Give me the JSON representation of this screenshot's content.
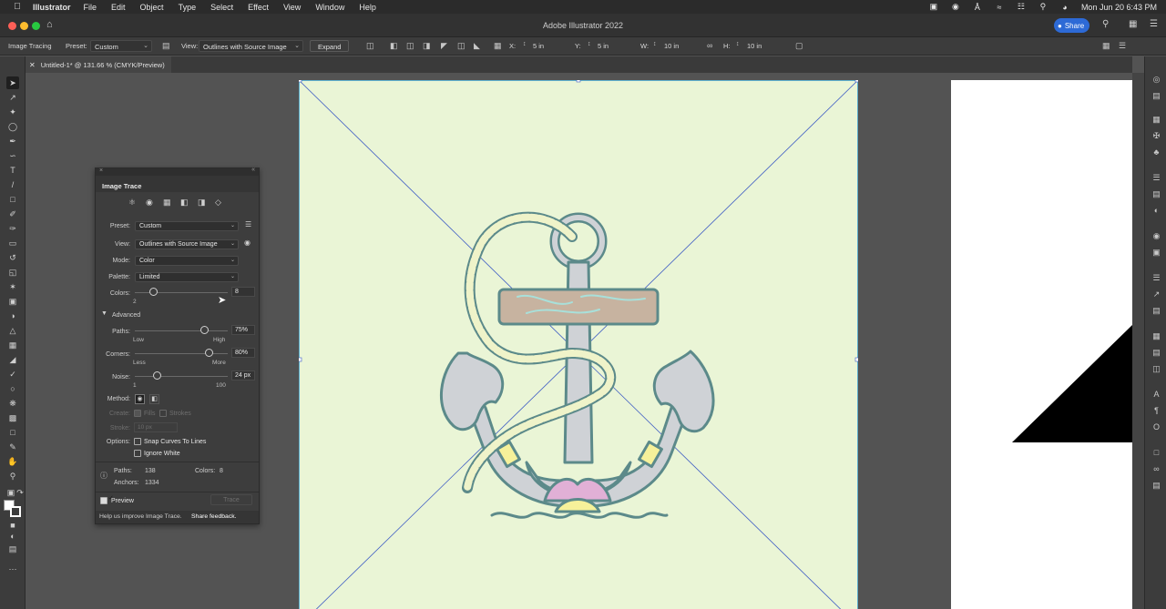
{
  "menubar": {
    "app": "Illustrator",
    "items": [
      "File",
      "Edit",
      "Object",
      "Type",
      "Select",
      "Effect",
      "View",
      "Window",
      "Help"
    ],
    "datetime": "Mon Jun 20  6:43 PM"
  },
  "window": {
    "title": "Adobe Illustrator 2022",
    "share": "Share"
  },
  "controlbar": {
    "image_tracing": "Image Tracing",
    "preset_label": "Preset:",
    "preset_value": "Custom",
    "view_label": "View:",
    "view_value": "Outlines with Source Image",
    "expand": "Expand",
    "x_label": "X:",
    "x_value": "5 in",
    "y_label": "Y:",
    "y_value": "5 in",
    "w_label": "W:",
    "w_value": "10 in",
    "h_label": "H:",
    "h_value": "10 in"
  },
  "document": {
    "tab": "Untitled-1* @ 131.66 % (CMYK/Preview)"
  },
  "panel": {
    "title": "Image Trace",
    "preset_label": "Preset:",
    "preset_value": "Custom",
    "view_label": "View:",
    "view_value": "Outlines with Source Image",
    "mode_label": "Mode:",
    "mode_value": "Color",
    "palette_label": "Palette:",
    "palette_value": "Limited",
    "colors_label": "Colors:",
    "colors_value": "8",
    "colors_min": "2",
    "advanced": "Advanced",
    "paths_label": "Paths:",
    "paths_value": "75%",
    "paths_low": "Low",
    "paths_high": "High",
    "corners_label": "Corners:",
    "corners_value": "80%",
    "corners_less": "Less",
    "corners_more": "More",
    "noise_label": "Noise:",
    "noise_value": "24 px",
    "noise_min": "1",
    "noise_max": "100",
    "method_label": "Method:",
    "create_label": "Create:",
    "fills": "Fills",
    "strokes": "Strokes",
    "stroke_label": "Stroke:",
    "stroke_value": "10 px",
    "options_label": "Options:",
    "snap_curves": "Snap Curves To Lines",
    "ignore_white": "Ignore White",
    "stats_paths_label": "Paths:",
    "stats_paths": "138",
    "stats_colors_label": "Colors:",
    "stats_colors": "8",
    "stats_anchors_label": "Anchors:",
    "stats_anchors": "1334",
    "preview": "Preview",
    "trace": "Trace",
    "feedback_text": "Help us improve Image Trace.",
    "feedback_link": "Share feedback."
  },
  "slider_levels": {
    "colors": 0.2,
    "paths": 0.75,
    "corners": 0.8,
    "noise": 0.24
  },
  "colors": {
    "share": "#2d6ad6",
    "artboard": "#eaf5d6",
    "anchor_outline": "#5c8a8a",
    "selection": "#3e5cc4"
  }
}
